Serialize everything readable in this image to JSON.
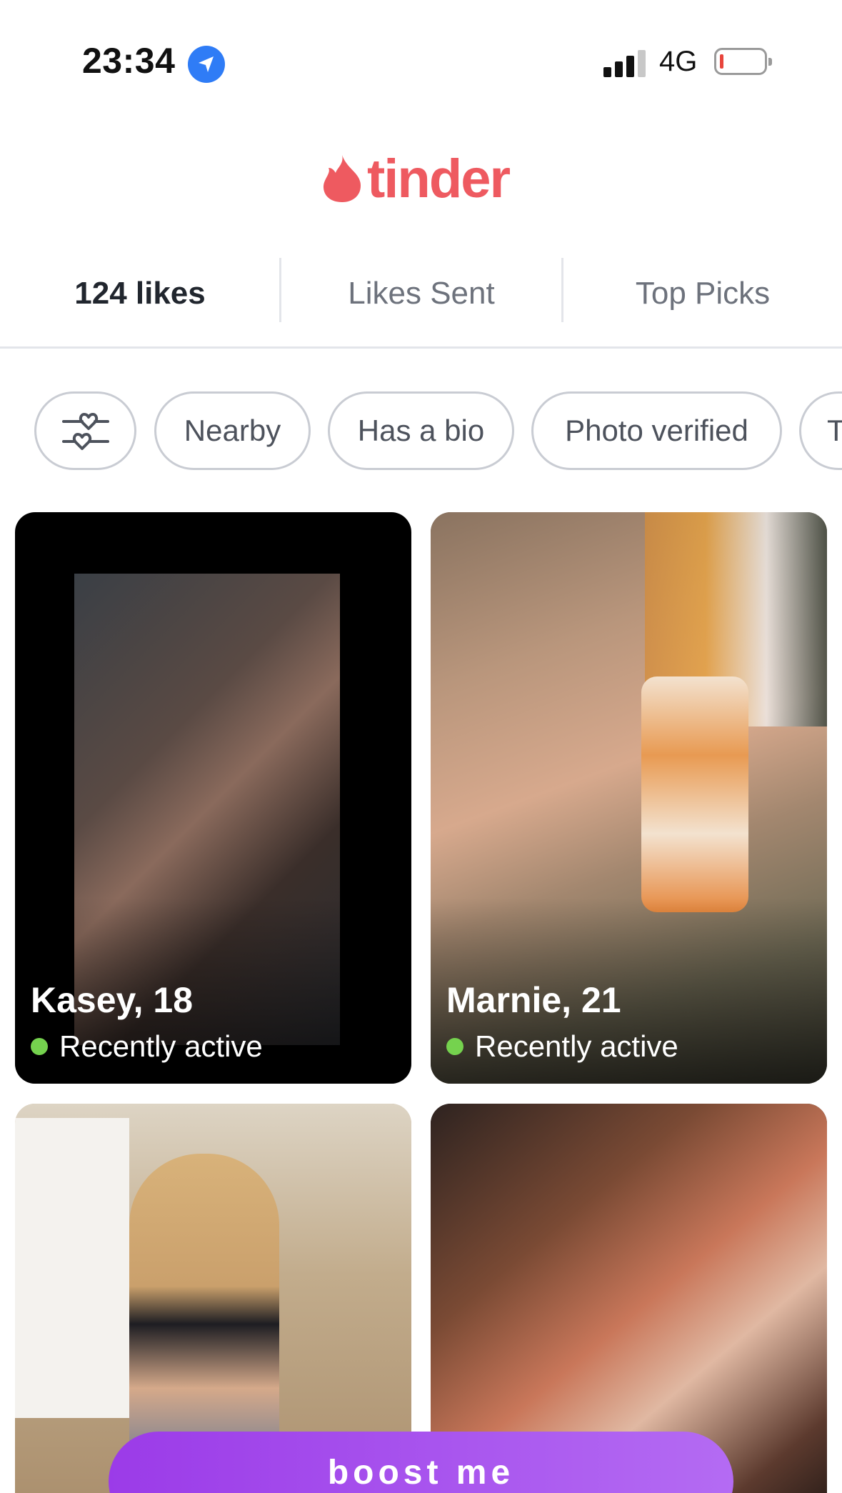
{
  "status_bar": {
    "time": "23:34",
    "network": "4G",
    "location_icon": "location-arrow-icon",
    "signal_icon": "cellular-signal-icon",
    "battery_icon": "battery-low-icon",
    "battery_level": 0.05
  },
  "app": {
    "logo_text": "tinder",
    "logo_icon": "flame-icon",
    "brand_color": "#ee5a60"
  },
  "tabs": [
    {
      "label": "124 likes",
      "active": true
    },
    {
      "label": "Likes Sent",
      "active": false
    },
    {
      "label": "Top Picks",
      "active": false
    }
  ],
  "filters": {
    "settings_icon": "filter-sliders-hearts-icon",
    "chips": [
      "Nearby",
      "Has a bio",
      "Photo verified",
      "T"
    ]
  },
  "cards": [
    {
      "name_age": "Kasey, 18",
      "status": "Recently active"
    },
    {
      "name_age": "Marnie, 21",
      "status": "Recently active"
    },
    {
      "name_age": "",
      "status": ""
    },
    {
      "name_age": "",
      "status": ""
    }
  ],
  "boost": {
    "label": "boost me",
    "color": "#a04ceb"
  }
}
